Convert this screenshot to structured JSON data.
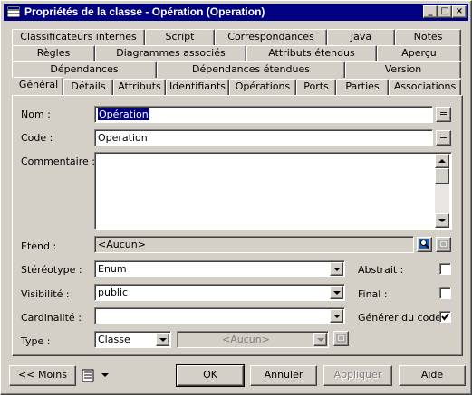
{
  "window": {
    "title": "Propriétés de la classe - Opération (Operation)",
    "controls": {
      "minimize": "_",
      "maximize": "□",
      "close": "×"
    }
  },
  "tabs": {
    "row1": [
      "Classificateurs internes",
      "Script",
      "Correspondances",
      "Java",
      "Notes"
    ],
    "row2": [
      "Règles",
      "Diagrammes associés",
      "Attributs étendus",
      "Aperçu"
    ],
    "row3": [
      "Dépendances",
      "Dépendances étendues",
      "Version"
    ],
    "row4": [
      "Général",
      "Détails",
      "Attributs",
      "Identifiants",
      "Opérations",
      "Ports",
      "Parties",
      "Associations"
    ],
    "active": "Général"
  },
  "form": {
    "nom": {
      "label": "Nom :",
      "value": "Opération"
    },
    "code": {
      "label": "Code :",
      "value": "Operation"
    },
    "equal_btn": "=",
    "commentaire": {
      "label": "Commentaire :",
      "value": ""
    },
    "etend": {
      "label": "Etend :",
      "value": "<Aucun>"
    },
    "stereotype": {
      "label": "Stéréotype :",
      "value": "Enum"
    },
    "visibilite": {
      "label": "Visibilité :",
      "value": "public"
    },
    "cardinalite": {
      "label": "Cardinalité :",
      "value": ""
    },
    "type": {
      "label": "Type :",
      "value": "Classe",
      "secondary": "<Aucun>"
    },
    "abstrait": {
      "label": "Abstrait :",
      "checked": false
    },
    "final": {
      "label": "Final :",
      "checked": false
    },
    "generer": {
      "label": "Générer du code :",
      "checked": true
    }
  },
  "buttons": {
    "moins": "<< Moins",
    "ok": "OK",
    "annuler": "Annuler",
    "appliquer": "Appliquer",
    "aide": "Aide"
  },
  "colors": {
    "face": "#d4d0c8",
    "titlebar": "#000080",
    "selection": "#000080"
  }
}
